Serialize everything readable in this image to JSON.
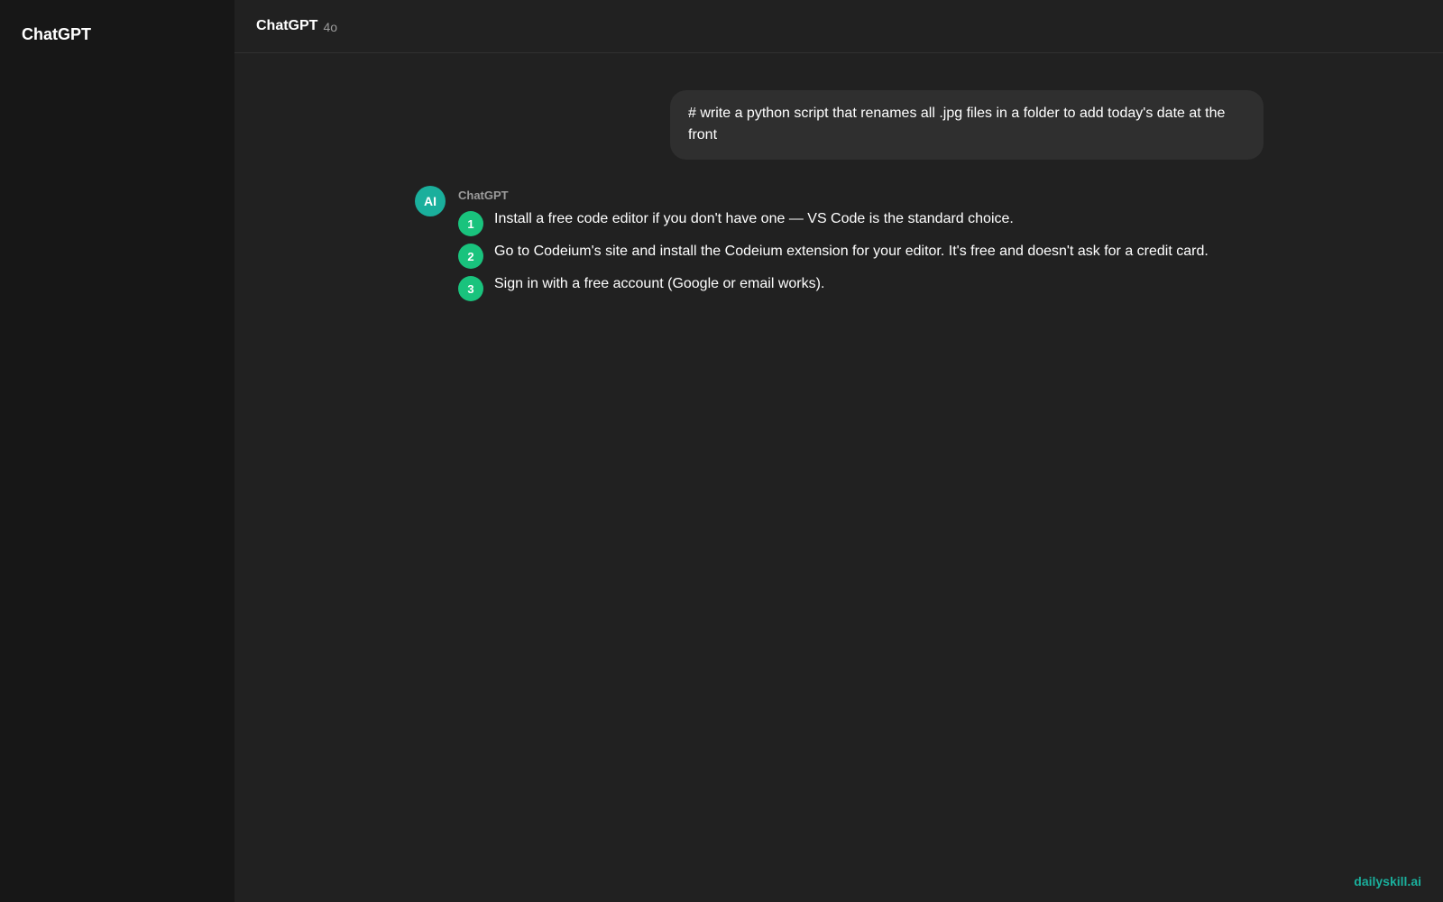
{
  "sidebar": {
    "brand": "ChatGPT"
  },
  "header": {
    "model_name": "ChatGPT",
    "model_version": "4o"
  },
  "conversation": {
    "user_message": "# write a python script that renames all .jpg files in a folder to add today's date at the front",
    "assistant": {
      "avatar_text": "AI",
      "sender": "ChatGPT",
      "steps": [
        {
          "number": "1",
          "text": "Install a free code editor if you don't have one — VS Code is the standard choice."
        },
        {
          "number": "2",
          "text": "Go to Codeium's site and install the Codeium extension for your editor. It's free and doesn't ask for a credit card."
        },
        {
          "number": "3",
          "text": "Sign in with a free account (Google or email works)."
        }
      ]
    }
  },
  "watermark": "dailyskill.ai",
  "colors": {
    "background": "#212121",
    "sidebar": "#171717",
    "user_bubble": "#2f2f2f",
    "avatar": "#1aaf9c",
    "step_badge": "#19c37d",
    "watermark": "#1aaf9c"
  }
}
